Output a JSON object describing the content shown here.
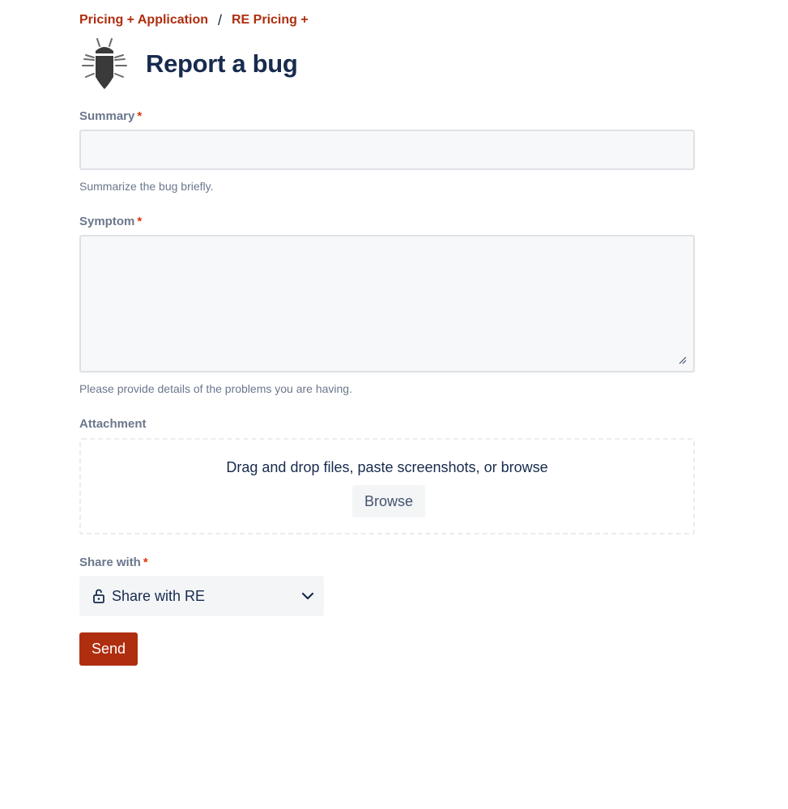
{
  "breadcrumbs": {
    "items": [
      {
        "label": "Pricing + Application"
      },
      {
        "label": "RE Pricing +"
      }
    ],
    "separator": "/"
  },
  "header": {
    "title": "Report a bug",
    "icon": "bug-icon"
  },
  "form": {
    "summary": {
      "label": "Summary",
      "required_mark": "*",
      "value": "",
      "help": "Summarize the bug briefly."
    },
    "symptom": {
      "label": "Symptom",
      "required_mark": "*",
      "value": "",
      "help": "Please provide details of the problems you are having."
    },
    "attachment": {
      "label": "Attachment",
      "dropzone_text": "Drag and drop files, paste screenshots, or browse",
      "browse_label": "Browse"
    },
    "share_with": {
      "label": "Share with",
      "required_mark": "*",
      "selected": "Share with RE",
      "icon": "lock-icon"
    },
    "send_label": "Send"
  },
  "colors": {
    "brand": "#ae2e0f",
    "title": "#172b4d",
    "label": "#6b778c",
    "required": "#de350b",
    "input_bg": "#f7f8f9",
    "input_border": "#dfe1e6"
  }
}
